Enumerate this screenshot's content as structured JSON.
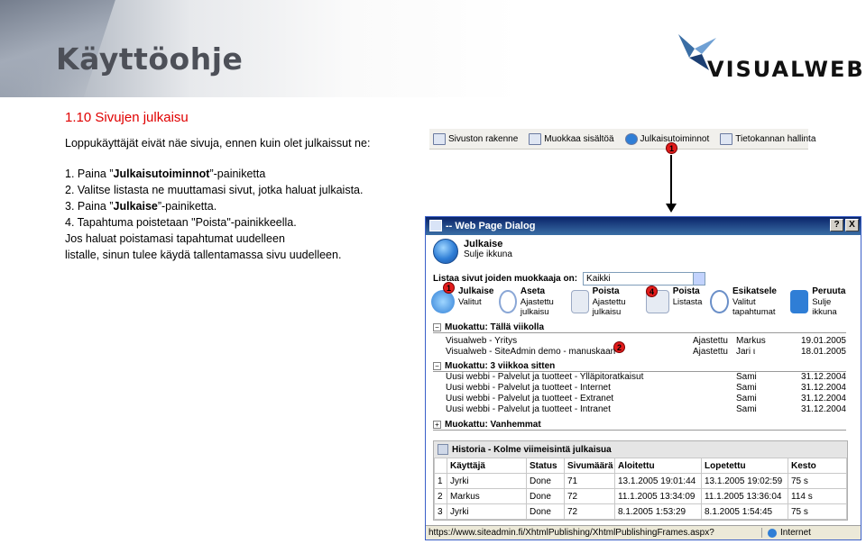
{
  "banner": {
    "title": "Käyttöohje",
    "logo_text": "VISUALWEB"
  },
  "doc": {
    "heading": "1.10 Sivujen julkaisu",
    "intro": "Loppukäyttäjät eivät näe sivuja, ennen kuin olet julkaissut ne:",
    "steps": [
      {
        "pre": "1. Paina ”",
        "bold": "Julkaisutoiminnot",
        "post": "”-painiketta"
      },
      {
        "text": "2. Valitse listasta ne muuttamasi sivut, jotka haluat julkaista."
      },
      {
        "pre": "3. Paina ”",
        "bold": "Julkaise",
        "post": "”-painiketta."
      },
      {
        "text": "4. Tapahtuma poistetaan \"Poista\"-painikkeella."
      },
      {
        "text": "Jos haluat poistamasi tapahtumat uudelleen"
      },
      {
        "text": "listalle, sinun tulee käydä tallentamassa sivu uudelleen."
      }
    ]
  },
  "toolbar": {
    "items": [
      "Sivuston rakenne",
      "Muokkaa sisältöä",
      "Julkaisutoiminnot",
      "Tietokannan hallinta"
    ]
  },
  "markers": {
    "m1": "1",
    "m1b": "1",
    "m2": "2",
    "m3": "3",
    "m4": "4"
  },
  "dialog": {
    "title": "-- Web Page Dialog",
    "ctrl_help": "?",
    "ctrl_close": "X",
    "pub_title": "Julkaise",
    "pub_sub": "Sulje ikkuna",
    "filter_label": "Listaa sivut joiden muokkaaja on:",
    "filter_value": "Kaikki",
    "actions": [
      {
        "label": "Julkaise",
        "sub": "Valitut",
        "color": "#2f7ed6"
      },
      {
        "label": "Aseta",
        "sub": "Ajastettu julkaisu",
        "color": "#8aa7d6"
      },
      {
        "label": "Poista",
        "sub": "Ajastettu julkaisu",
        "color": "#c9d6ea"
      },
      {
        "label": "Poista",
        "sub": "Listasta",
        "color": "#c9d6ea"
      },
      {
        "label": "Esikatsele",
        "sub": "Valitut tapahtumat",
        "color": "#dbe6f4"
      },
      {
        "label": "Peruuta",
        "sub": "Sulje ikkuna",
        "color": "#2f7ed6"
      }
    ],
    "groups": [
      {
        "title": "Muokattu: Tällä viikolla",
        "toggle": "−",
        "rows": [
          {
            "title": "Visualweb - Yritys",
            "action": "Ajastettu",
            "user": "Markus",
            "date": "19.01.2005"
          },
          {
            "title": "Visualweb - SiteAdmin demo - manuskaan",
            "action": "Ajastettu",
            "user": "Jari ι",
            "date": "18.01.2005"
          }
        ]
      },
      {
        "title": "Muokattu: 3 viikkoa sitten",
        "toggle": "−",
        "rows": [
          {
            "title": "Uusi webbi - Palvelut ja tuotteet - Ylläpitoratkaisut",
            "action": "",
            "user": "Sami",
            "date": "31.12.2004"
          },
          {
            "title": "Uusi webbi - Palvelut ja tuotteet - Internet",
            "action": "",
            "user": "Sami",
            "date": "31.12.2004"
          },
          {
            "title": "Uusi webbi - Palvelut ja tuotteet - Extranet",
            "action": "",
            "user": "Sami",
            "date": "31.12.2004"
          },
          {
            "title": "Uusi webbi - Palvelut ja tuotteet - Intranet",
            "action": "",
            "user": "Sami",
            "date": "31.12.2004"
          }
        ]
      },
      {
        "title": "Muokattu: Vanhemmat",
        "toggle": "+",
        "rows": []
      }
    ],
    "history": {
      "title": "Historia - Kolme viimeisintä julkaisua",
      "columns": [
        "",
        "Käyttäjä",
        "Status",
        "Sivumäärä",
        "Aloitettu",
        "Lopetettu",
        "Kesto"
      ],
      "rows": [
        [
          "1",
          "Jyrki",
          "Done",
          "71",
          "13.1.2005 19:01:44",
          "13.1.2005 19:02:59",
          "75 s"
        ],
        [
          "2",
          "Markus",
          "Done",
          "72",
          "11.1.2005 13:34:09",
          "11.1.2005 13:36:04",
          "114 s"
        ],
        [
          "3",
          "Jyrki",
          "Done",
          "72",
          "8.1.2005 1:53:29",
          "8.1.2005 1:54:45",
          "75 s"
        ]
      ]
    },
    "statusbar": {
      "url": "https://www.siteadmin.fi/XhtmlPublishing/XhtmlPublishingFrames.aspx?",
      "zone": "Internet"
    }
  },
  "colors": {
    "heading": "#e00000",
    "marker": "#e21b1b",
    "titlebar": "#0a246a"
  }
}
